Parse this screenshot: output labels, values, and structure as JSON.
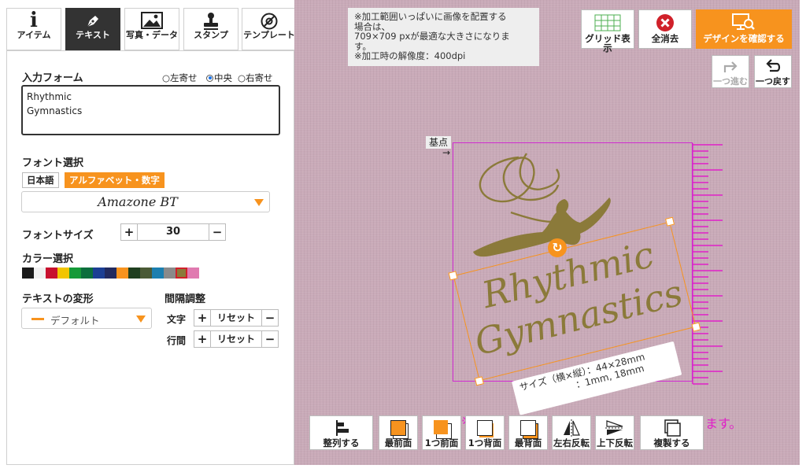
{
  "tabs": [
    {
      "label": "アイテム",
      "icon": "info-icon",
      "glyph": "i"
    },
    {
      "label": "テキスト",
      "icon": "pen-icon",
      "glyph": "✒"
    },
    {
      "label": "写真・データ",
      "icon": "image-icon",
      "glyph": "🖼"
    },
    {
      "label": "スタンプ",
      "icon": "stamp-icon",
      "glyph": "⊥"
    },
    {
      "label": "テンプレート",
      "icon": "template-icon",
      "glyph": "⊘"
    }
  ],
  "input_form": {
    "heading": "入力フォーム",
    "align_left": "○左寄せ",
    "align_center": "中央",
    "align_right": "○右寄せ",
    "text_line1": "Rhythmic",
    "text_line2": "Gymnastics",
    "value": "Rhythmic\nGymnastics"
  },
  "font_select": {
    "heading": "フォント選択",
    "japanese": "日本語",
    "alphabet": "アルファベット・数字",
    "current_font": "Amazone BT"
  },
  "font_size": {
    "heading": "フォントサイズ",
    "value": "30",
    "plus": "+",
    "minus": "−"
  },
  "color_select": {
    "heading": "カラー選択",
    "colors": [
      "#1a1a1a",
      "#f0f0f0",
      "#c8102e",
      "#f2c500",
      "#159a38",
      "#0b6e3d",
      "#1c3f94",
      "#222a5e",
      "#f7931e",
      "#1f3f1f",
      "#4a5a36",
      "#1c7fb0",
      "#8a8a8a",
      "#8b7a3a",
      "#e07ab0"
    ],
    "selected_index": 13
  },
  "text_transform": {
    "heading": "テキストの変形",
    "current": "デフォルト"
  },
  "spacing": {
    "heading": "間隔調整",
    "char_label": "文字",
    "line_label": "行間",
    "plus": "+",
    "reset": "リセット",
    "minus": "−"
  },
  "notice": {
    "line1": "※加工範囲いっぱいに画像を配置する",
    "line2": "場合は、",
    "line3": "709×709 pxが最適な大きさになりま",
    "line4": "す。",
    "line5": "※加工時の解像度：400dpi"
  },
  "toolbar": {
    "grid": "グリッド表示",
    "clear": "全消去",
    "confirm": "デザインを確認する",
    "redo": "一つ進む",
    "undo": "一つ戻す"
  },
  "canvas": {
    "base_point": "基点",
    "design_line1": "Rhythmic",
    "design_line2": "Gymnastics",
    "size_label_1": "サイズ（横×縦）：44×28mm",
    "size_label_2": "：1mm, 18mm",
    "background_message_tail": "ます。",
    "background_message_head": "※"
  },
  "bottom_toolbar": {
    "align": "整列する",
    "front_most": "最前面",
    "front_one": "1つ前面",
    "back_one": "1つ背面",
    "back_most": "最背面",
    "flip_h": "左右反転",
    "flip_v": "上下反転",
    "duplicate": "複製する"
  },
  "accent": "#f7931e",
  "clear_red": "#d0212a",
  "ruler_color": "#e020c8"
}
